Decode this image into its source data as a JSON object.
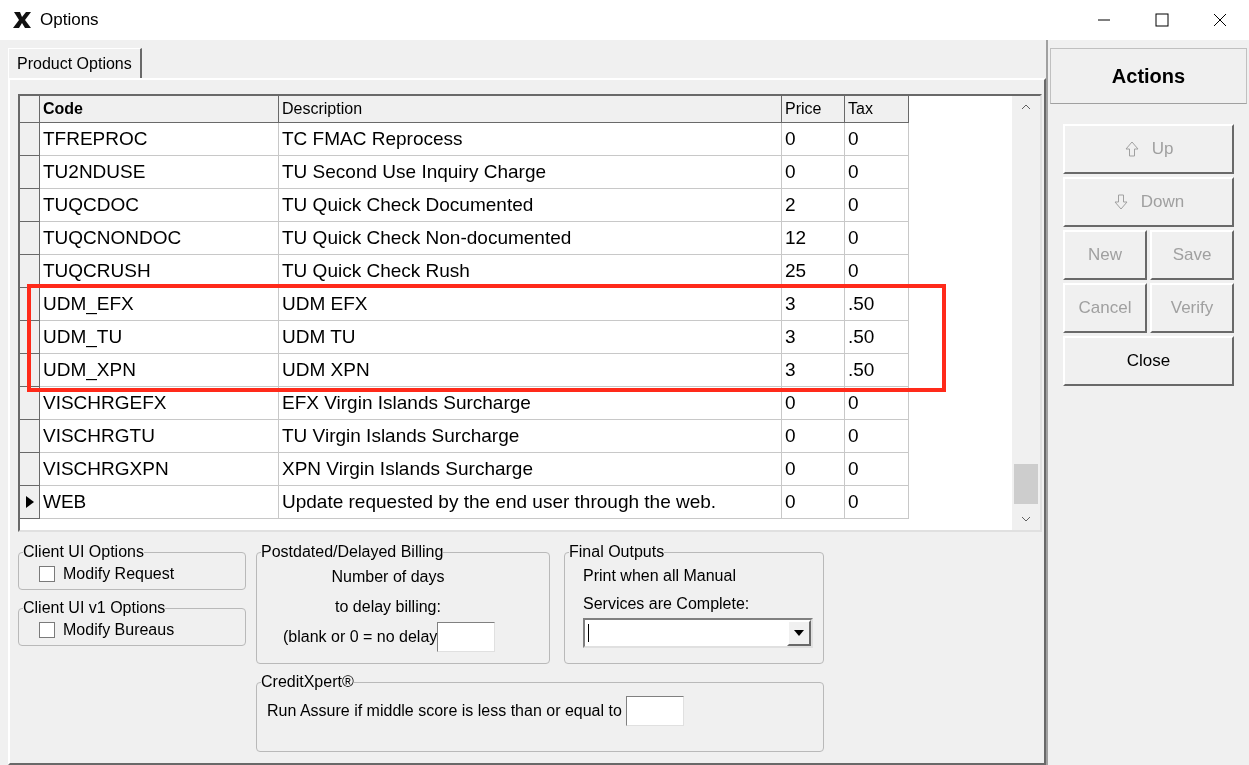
{
  "window": {
    "title": "Options"
  },
  "tabs": [
    {
      "label": "Product Options",
      "selected": true
    }
  ],
  "table": {
    "columns": [
      "Code",
      "Description",
      "Price",
      "Tax"
    ],
    "rows": [
      {
        "code": "TFREPROC",
        "description": "TC FMAC Reprocess",
        "price": "0",
        "tax": "0",
        "selected": false
      },
      {
        "code": "TU2NDUSE",
        "description": "TU Second Use Inquiry Charge",
        "price": "0",
        "tax": "0",
        "selected": false
      },
      {
        "code": "TUQCDOC",
        "description": "TU Quick Check Documented",
        "price": "2",
        "tax": "0",
        "selected": false
      },
      {
        "code": "TUQCNONDOC",
        "description": "TU Quick Check Non-documented",
        "price": "12",
        "tax": "0",
        "selected": false
      },
      {
        "code": "TUQCRUSH",
        "description": "TU Quick Check Rush",
        "price": "25",
        "tax": "0",
        "selected": false
      },
      {
        "code": "UDM_EFX",
        "description": "UDM EFX",
        "price": "3",
        "tax": ".50",
        "selected": false
      },
      {
        "code": "UDM_TU",
        "description": "UDM TU",
        "price": "3",
        "tax": ".50",
        "selected": false
      },
      {
        "code": "UDM_XPN",
        "description": "UDM XPN",
        "price": "3",
        "tax": ".50",
        "selected": false
      },
      {
        "code": "VISCHRGEFX",
        "description": "EFX Virgin Islands Surcharge",
        "price": "0",
        "tax": "0",
        "selected": false
      },
      {
        "code": "VISCHRGTU",
        "description": "TU Virgin Islands Surcharge",
        "price": "0",
        "tax": "0",
        "selected": false
      },
      {
        "code": "VISCHRGXPN",
        "description": "XPN Virgin Islands Surcharge",
        "price": "0",
        "tax": "0",
        "selected": false
      },
      {
        "code": "WEB",
        "description": "Update requested by the end user through the web.",
        "price": "0",
        "tax": "0",
        "selected": true
      }
    ]
  },
  "client_ui_options": {
    "title": "Client UI Options",
    "checkbox": {
      "label": "Modify Request",
      "checked": false
    }
  },
  "client_ui_v1_options": {
    "title": "Client UI v1 Options",
    "checkbox": {
      "label": "Modify Bureaus",
      "checked": false
    }
  },
  "postdated_billing": {
    "title": "Postdated/Delayed Billing",
    "lines": [
      "Number of days",
      "to delay billing:"
    ],
    "field_label": "(blank or 0 = no delay"
  },
  "final_outputs": {
    "title": "Final Outputs",
    "lines": [
      "Print when all Manual",
      "Services are Complete:"
    ]
  },
  "creditxpert": {
    "title": "CreditXpert®",
    "field_label": "Run Assure if middle score is less than or equal to"
  },
  "actions": {
    "title": "Actions",
    "buttons": [
      {
        "label": "Up",
        "kind": "up",
        "disabled": true
      },
      {
        "label": "Down",
        "kind": "down",
        "disabled": true
      },
      {
        "label": "New",
        "kind": "half",
        "disabled": true
      },
      {
        "label": "Save",
        "kind": "half",
        "disabled": true
      },
      {
        "label": "Cancel",
        "kind": "half",
        "disabled": true
      },
      {
        "label": "Verify",
        "kind": "half",
        "disabled": true
      },
      {
        "label": "Close",
        "kind": "full",
        "disabled": false
      }
    ]
  }
}
